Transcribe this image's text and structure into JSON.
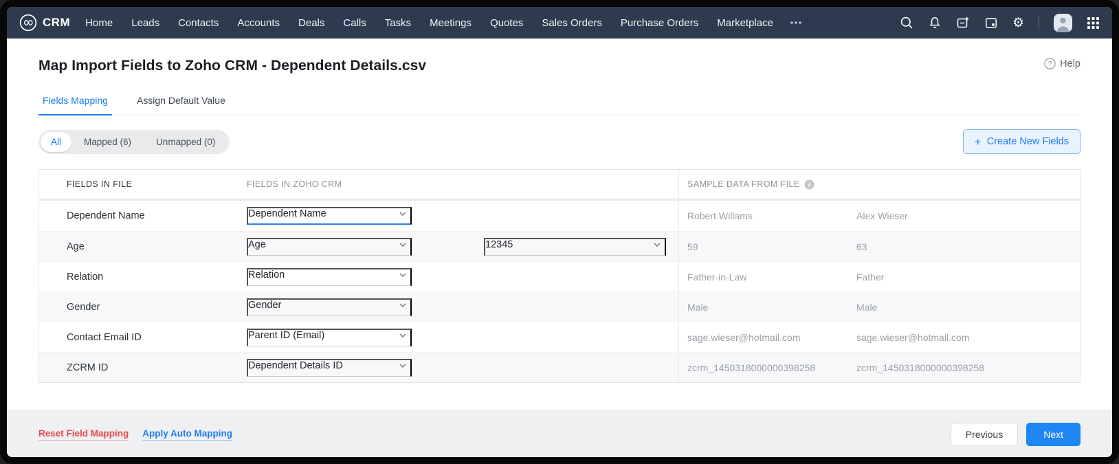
{
  "nav": {
    "brand": "CRM",
    "items": [
      "Home",
      "Leads",
      "Contacts",
      "Accounts",
      "Deals",
      "Calls",
      "Tasks",
      "Meetings",
      "Quotes",
      "Sales Orders",
      "Purchase Orders",
      "Marketplace"
    ]
  },
  "page": {
    "title": "Map Import Fields to Zoho CRM - Dependent Details.csv",
    "help_label": "Help"
  },
  "tabs": {
    "fields_mapping": "Fields Mapping",
    "assign_default_value": "Assign Default Value"
  },
  "filters": {
    "all": "All",
    "mapped": "Mapped (6)",
    "unmapped": "Unmapped (0)"
  },
  "create_button": {
    "plus": "+",
    "label": "Create New Fields"
  },
  "table": {
    "headers": {
      "fields_in_file": "FIELDS IN FILE",
      "fields_in_zoho_crm": "FIELDS IN ZOHO CRM",
      "sample_data_from_file": "SAMPLE DATA FROM FILE"
    },
    "rows": [
      {
        "file_field": "Dependent Name",
        "crm_field": "Dependent Name",
        "sample1": "Robert Willams",
        "sample2": "Alex Wieser"
      },
      {
        "file_field": "Age",
        "crm_field": "Age",
        "extra_value": "12345",
        "sample1": "59",
        "sample2": "63"
      },
      {
        "file_field": "Relation",
        "crm_field": "Relation",
        "sample1": "Father-in-Law",
        "sample2": "Father"
      },
      {
        "file_field": "Gender",
        "crm_field": "Gender",
        "sample1": "Male",
        "sample2": "Male"
      },
      {
        "file_field": "Contact Email ID",
        "crm_field": "Parent ID (Email)",
        "sample1": "sage.wieser@hotmail.com",
        "sample2": "sage.wieser@hotmail.com"
      },
      {
        "file_field": "ZCRM ID",
        "crm_field": "Dependent Details ID",
        "sample1": "zcrm_1450318000000398258",
        "sample2": "zcrm_1450318000000398258"
      }
    ]
  },
  "footer": {
    "reset_label": "Reset Field Mapping",
    "auto_label": "Apply Auto Mapping",
    "previous_label": "Previous",
    "next_label": "Next"
  },
  "colors": {
    "accent": "#1d7df3",
    "danger": "#e5484d",
    "nav_bg": "#2e3b4f",
    "next_button": "#1e87f3",
    "row_alt": "#f7f8f9"
  }
}
